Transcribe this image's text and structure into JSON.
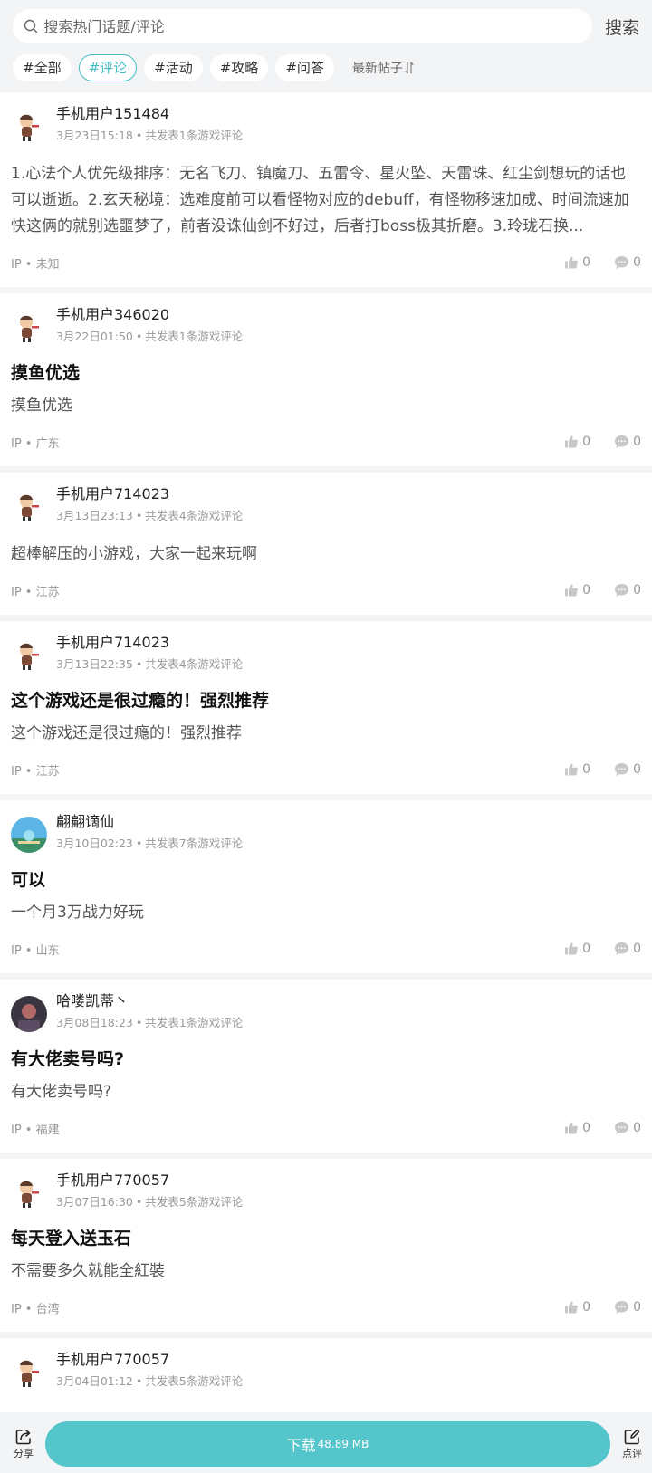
{
  "search": {
    "placeholder": "搜索热门话题/评论",
    "button": "搜索"
  },
  "tags": [
    "#全部",
    "#评论",
    "#活动",
    "#攻略",
    "#问答"
  ],
  "active_tag": "#评论",
  "sort_label": "最新帖子",
  "posts": [
    {
      "user": "手机用户151484",
      "time": "3月23日15:18",
      "meta": "共发表1条游戏评论",
      "title": "",
      "body": "1.心法个人优先级排序：无名飞刀、镇魔刀、五雷令、星火坠、天雷珠、红尘剑想玩的话也可以逝逝。2.玄天秘境：选难度前可以看怪物对应的debuff，有怪物移速加成、时间流速加快这俩的就别选噩梦了，前者没诛仙剑不好过，后者打boss极其折磨。3.玲珑石换...",
      "ip": "IP • 未知",
      "likes": "0",
      "comments": "0"
    },
    {
      "user": "手机用户346020",
      "time": "3月22日01:50",
      "meta": "共发表1条游戏评论",
      "title": "摸鱼优选",
      "body": "摸鱼优选",
      "ip": "IP • 广东",
      "likes": "0",
      "comments": "0"
    },
    {
      "user": "手机用户714023",
      "time": "3月13日23:13",
      "meta": "共发表4条游戏评论",
      "title": "",
      "body": "超棒解压的小游戏，大家一起来玩啊",
      "ip": "IP • 江苏",
      "likes": "0",
      "comments": "0"
    },
    {
      "user": "手机用户714023",
      "time": "3月13日22:35",
      "meta": "共发表4条游戏评论",
      "title": "这个游戏还是很过瘾的！强烈推荐",
      "body": "这个游戏还是很过瘾的！强烈推荐",
      "ip": "IP • 江苏",
      "likes": "0",
      "comments": "0"
    },
    {
      "user": "翩翩谪仙",
      "time": "3月10日02:23",
      "meta": "共发表7条游戏评论",
      "title": "可以",
      "body": "一个月3万战力好玩",
      "ip": "IP • 山东",
      "likes": "0",
      "comments": "0"
    },
    {
      "user": "哈喽凯蒂丶",
      "time": "3月08日18:23",
      "meta": "共发表1条游戏评论",
      "title": "有大佬卖号吗?",
      "body": "有大佬卖号吗?",
      "ip": "IP • 福建",
      "likes": "0",
      "comments": "0"
    },
    {
      "user": "手机用户770057",
      "time": "3月07日16:30",
      "meta": "共发表5条游戏评论",
      "title": "每天登入送玉石",
      "body": "不需要多久就能全紅裝",
      "ip": "IP • 台湾",
      "likes": "0",
      "comments": "0"
    },
    {
      "user": "手机用户770057",
      "time": "3月04日01:12",
      "meta": "共发表5条游戏评论",
      "title": "",
      "body": "",
      "ip": "",
      "likes": "",
      "comments": ""
    }
  ],
  "bottom": {
    "share": "分享",
    "download": "下载",
    "download_size": "48.89 MB",
    "review": "点评"
  }
}
